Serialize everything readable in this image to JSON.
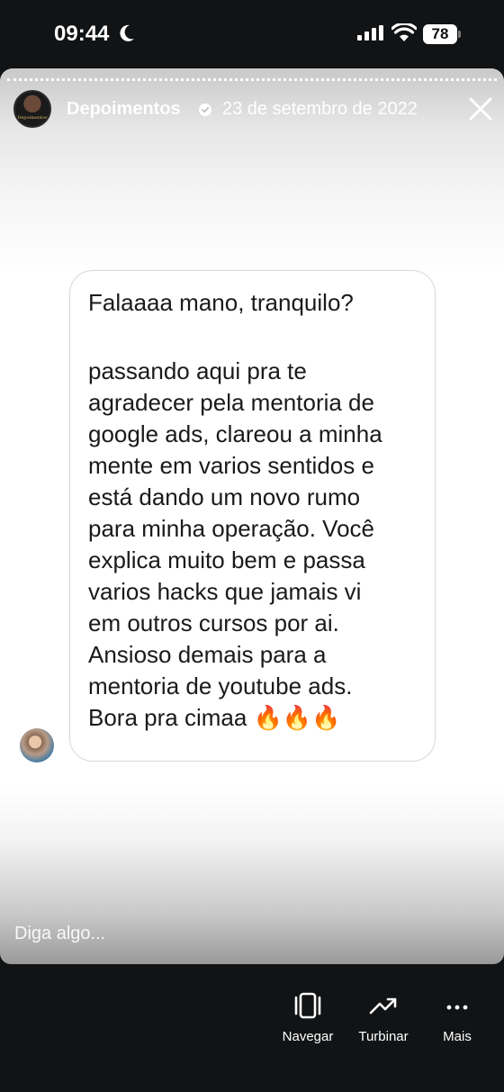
{
  "status_bar": {
    "time": "09:44",
    "battery": "78"
  },
  "story": {
    "username": "Depoimentos",
    "date": "23 de setembro de 2022",
    "avatar_logo_text": "Depoimentos",
    "message_lines": [
      "Falaaaa mano, tranquilo?",
      "",
      "passando aqui pra te",
      "agradecer pela mentoria de",
      "google ads, clareou a minha",
      "mente em varios sentidos e",
      "está dando um novo rumo",
      "para minha operação. Você",
      "explica muito bem e passa",
      "varios hacks que jamais vi",
      "em outros cursos por ai.",
      "Ansioso demais para a",
      "mentoria de youtube ads.",
      "Bora pra cimaa 🔥🔥🔥"
    ],
    "reply_placeholder": "Diga algo..."
  },
  "bottom_bar": {
    "navegar": "Navegar",
    "turbinar": "Turbinar",
    "mais": "Mais"
  }
}
